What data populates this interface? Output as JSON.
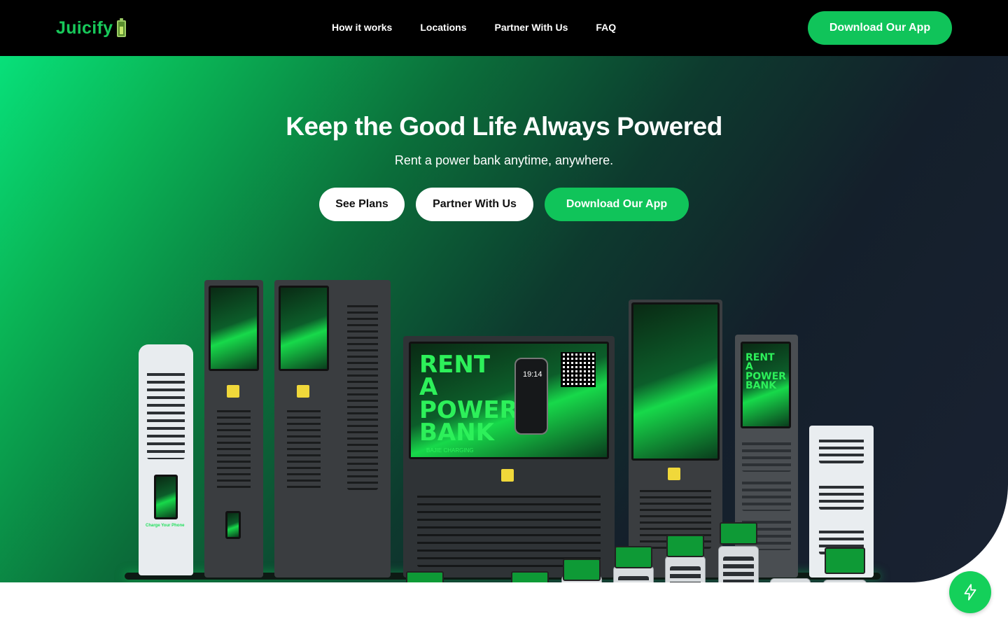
{
  "header": {
    "brand": "Juicify",
    "logo_icon": "battery-icon",
    "nav": [
      "How it works",
      "Locations",
      "Partner With Us",
      "FAQ"
    ],
    "cta": "Download Our App"
  },
  "hero": {
    "title": "Keep the Good Life Always Powered",
    "subtitle": "Rent a power bank anytime, anywhere.",
    "buttons": {
      "plans": "See Plans",
      "partner": "Partner With Us",
      "download": "Download Our App"
    },
    "illustration": {
      "main_screen_text": "RENT A POWER BANK",
      "main_screen_brand": "BAJIE CHARGING",
      "side_screen_text": "RENT A POWER BANK",
      "small_label": "Charge Your Phone",
      "phone_time": "19:14"
    }
  },
  "floating": {
    "icon": "lightning-icon"
  },
  "colors": {
    "accent": "#10c45a",
    "bar": "#000000",
    "brand_text": "#18c85a"
  }
}
